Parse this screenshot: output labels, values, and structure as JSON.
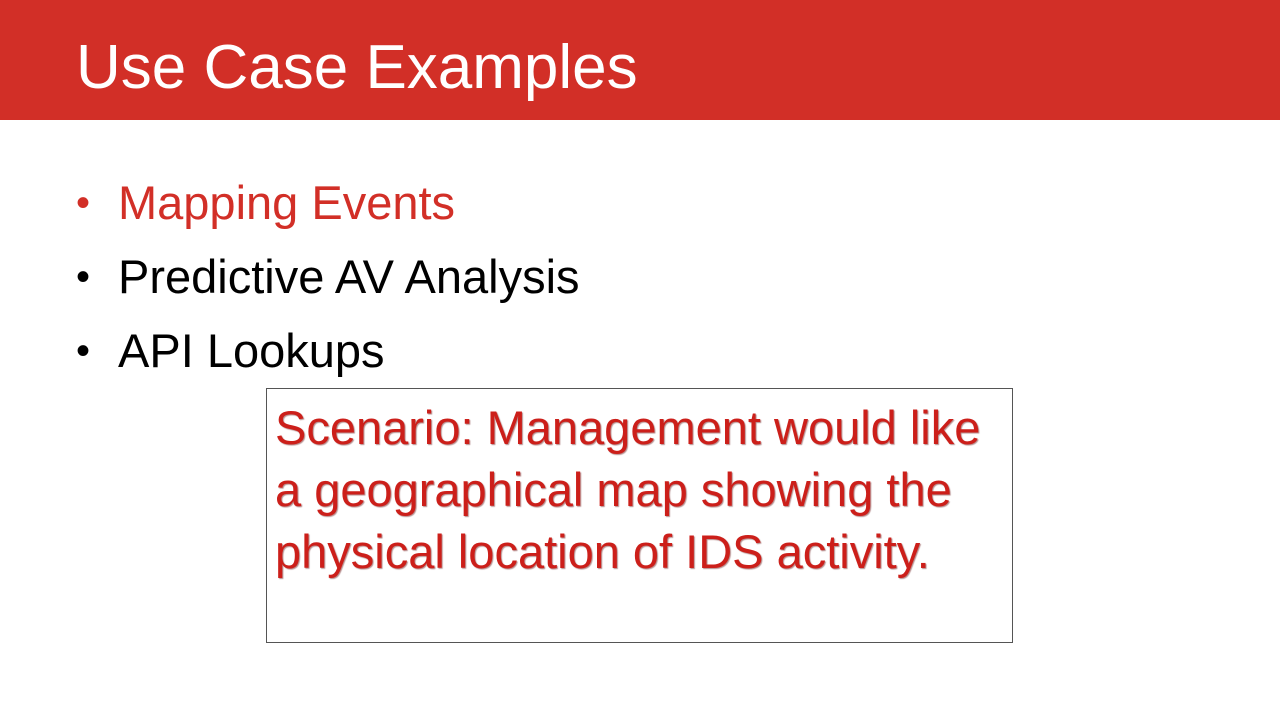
{
  "slide": {
    "title": "Use Case Examples",
    "bullets": [
      {
        "label": "Mapping Events",
        "active": true
      },
      {
        "label": "Predictive AV Analysis",
        "active": false
      },
      {
        "label": "API Lookups",
        "active": false
      }
    ],
    "bullet_glyph": "•",
    "scenario": "Scenario: Management would like a geographical map showing the physical location of IDS activity."
  },
  "colors": {
    "accent": "#d22f27",
    "scenario_text": "#cc1f1a",
    "body_text": "#000000",
    "title_text": "#ffffff"
  }
}
